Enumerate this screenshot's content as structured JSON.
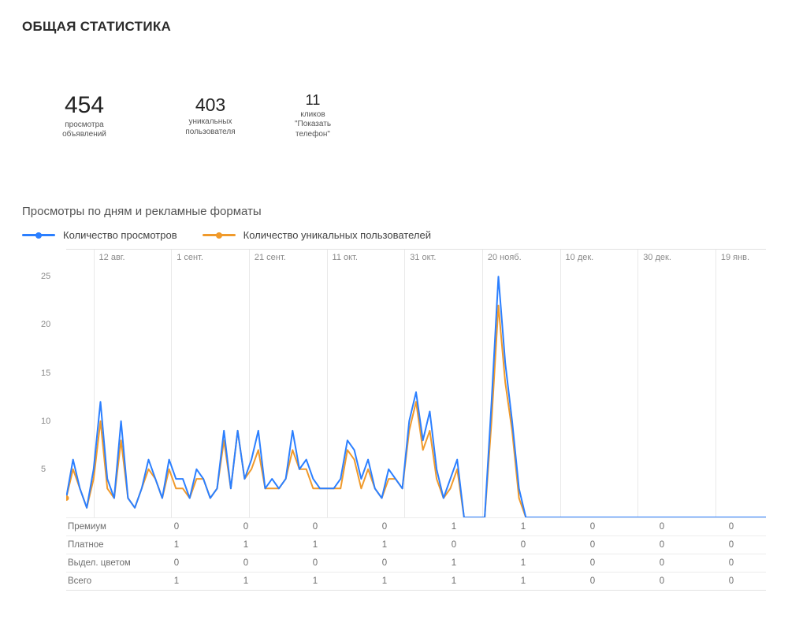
{
  "title": "ОБЩАЯ СТАТИСТИКА",
  "circles": [
    {
      "value": "454",
      "label": "просмотра\nобъявлений"
    },
    {
      "value": "403",
      "label": "уникальных\nпользователя"
    },
    {
      "value": "11",
      "label": "кликов\n\"Показать\nтелефон\""
    }
  ],
  "chart_section_title": "Просмотры по дням и рекламные форматы",
  "legend": {
    "views": "Количество просмотров",
    "unique": "Количество уникальных пользователей"
  },
  "table": {
    "rows": [
      "Премиум",
      "Платное",
      "Выдел. цветом",
      "Всего"
    ],
    "data": [
      [
        0,
        0,
        0,
        0,
        1,
        1,
        0,
        0,
        0
      ],
      [
        1,
        1,
        1,
        1,
        0,
        0,
        0,
        0,
        0
      ],
      [
        0,
        0,
        0,
        0,
        1,
        1,
        0,
        0,
        0
      ],
      [
        1,
        1,
        1,
        1,
        1,
        1,
        0,
        0,
        0
      ]
    ]
  },
  "chart_data": {
    "type": "line",
    "x_ticks": [
      "12 авг.",
      "1 сент.",
      "21 сент.",
      "11 окт.",
      "31 окт.",
      "20 нояб.",
      "10 дек.",
      "30 дек.",
      "19 янв."
    ],
    "ylim": [
      0,
      26
    ],
    "y_ticks": [
      5,
      10,
      15,
      20,
      25
    ],
    "series": [
      {
        "name": "Количество просмотров",
        "color": "#2b7fff",
        "values": [
          2,
          6,
          3,
          1,
          5,
          12,
          4,
          2,
          10,
          2,
          1,
          3,
          6,
          4,
          2,
          6,
          4,
          4,
          2,
          5,
          4,
          2,
          3,
          9,
          3,
          9,
          4,
          6,
          9,
          3,
          4,
          3,
          4,
          9,
          5,
          6,
          4,
          3,
          3,
          3,
          4,
          8,
          7,
          4,
          6,
          3,
          2,
          5,
          4,
          3,
          10,
          13,
          8,
          11,
          5,
          2,
          4,
          6,
          0,
          0,
          0,
          0,
          12,
          25,
          16,
          10,
          3,
          0,
          0,
          0,
          0,
          0,
          0,
          0,
          0,
          0,
          0,
          0,
          0,
          0,
          0,
          0,
          0,
          0,
          0,
          0,
          0,
          0,
          0,
          0,
          0,
          0,
          0,
          0,
          0,
          0,
          0,
          0,
          0,
          0,
          0,
          0,
          0
        ]
      },
      {
        "name": "Количество уникальных пользователей",
        "color": "#f09a2b",
        "values": [
          2,
          5,
          3,
          1,
          4,
          10,
          3,
          2,
          8,
          2,
          1,
          3,
          5,
          4,
          2,
          5,
          3,
          3,
          2,
          4,
          4,
          2,
          3,
          8,
          3,
          9,
          4,
          5,
          7,
          3,
          3,
          3,
          4,
          7,
          5,
          5,
          3,
          3,
          3,
          3,
          3,
          7,
          6,
          3,
          5,
          3,
          2,
          4,
          4,
          3,
          9,
          12,
          7,
          9,
          4,
          2,
          3,
          5,
          0,
          0,
          0,
          0,
          10,
          22,
          14,
          9,
          2,
          0,
          0,
          0,
          0,
          0,
          0,
          0,
          0,
          0,
          0,
          0,
          0,
          0,
          0,
          0,
          0,
          0,
          0,
          0,
          0,
          0,
          0,
          0,
          0,
          0,
          0,
          0,
          0,
          0,
          0,
          0,
          0,
          0,
          0,
          0,
          0
        ]
      }
    ]
  }
}
